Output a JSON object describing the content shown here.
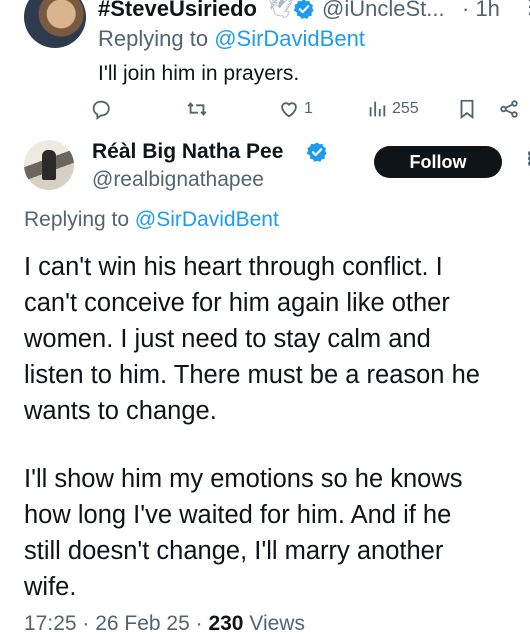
{
  "reply_tweet": {
    "name": "#SteveUsiriedo",
    "handle": "@iUncleSt...",
    "time": "· 1h",
    "replying_prefix": "Replying to ",
    "replying_to": "@SirDavidBent",
    "text": "I'll join him in prayers.",
    "actions": {
      "likes": "1",
      "views": "255"
    }
  },
  "main_tweet": {
    "name": "Réàl Big Natha Pee",
    "handle": "@realbignathapee",
    "follow_label": "Follow",
    "replying_prefix": "Replying to ",
    "replying_to": "@SirDavidBent",
    "lines": [
      "I can't win his heart through conflict. I",
      "can't conceive for him again like other",
      "women. I just need to stay calm and",
      "listen to him. There must be a reason he",
      "wants to change.",
      "I'll show him my emotions so he knows",
      "how long I've waited for him. And if he",
      "still doesn't change, I'll marry another",
      "wife."
    ],
    "timestamp": "17:25 · 26 Feb 25 · ",
    "views_count": "230",
    "views_label": " Views"
  },
  "colors": {
    "accent": "#1d9bf0",
    "text": "#0f1419",
    "muted": "#536471"
  }
}
